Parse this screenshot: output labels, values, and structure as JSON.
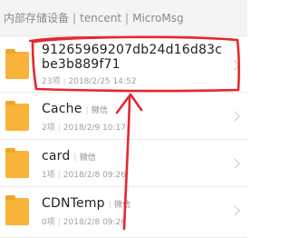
{
  "breadcrumb": {
    "items": [
      "内部存储设备",
      "tencent",
      "MicroMsg"
    ],
    "separator": "|"
  },
  "folders": [
    {
      "name": "91265969207db24d16d83cbe3b889f71",
      "tag": "",
      "count": "23项",
      "date": "2018/2/25 14:52"
    },
    {
      "name": "Cache",
      "tag": "微信",
      "count": "2项",
      "date": "2018/2/9 10:17"
    },
    {
      "name": "card",
      "tag": "微信",
      "count": "1项",
      "date": "2018/2/8 09:26"
    },
    {
      "name": "CDNTemp",
      "tag": "微信",
      "count": "0项",
      "date": "2018/2/8 09:26"
    }
  ],
  "colors": {
    "folder": "#f7b33a",
    "annotation": "#e8262d"
  }
}
